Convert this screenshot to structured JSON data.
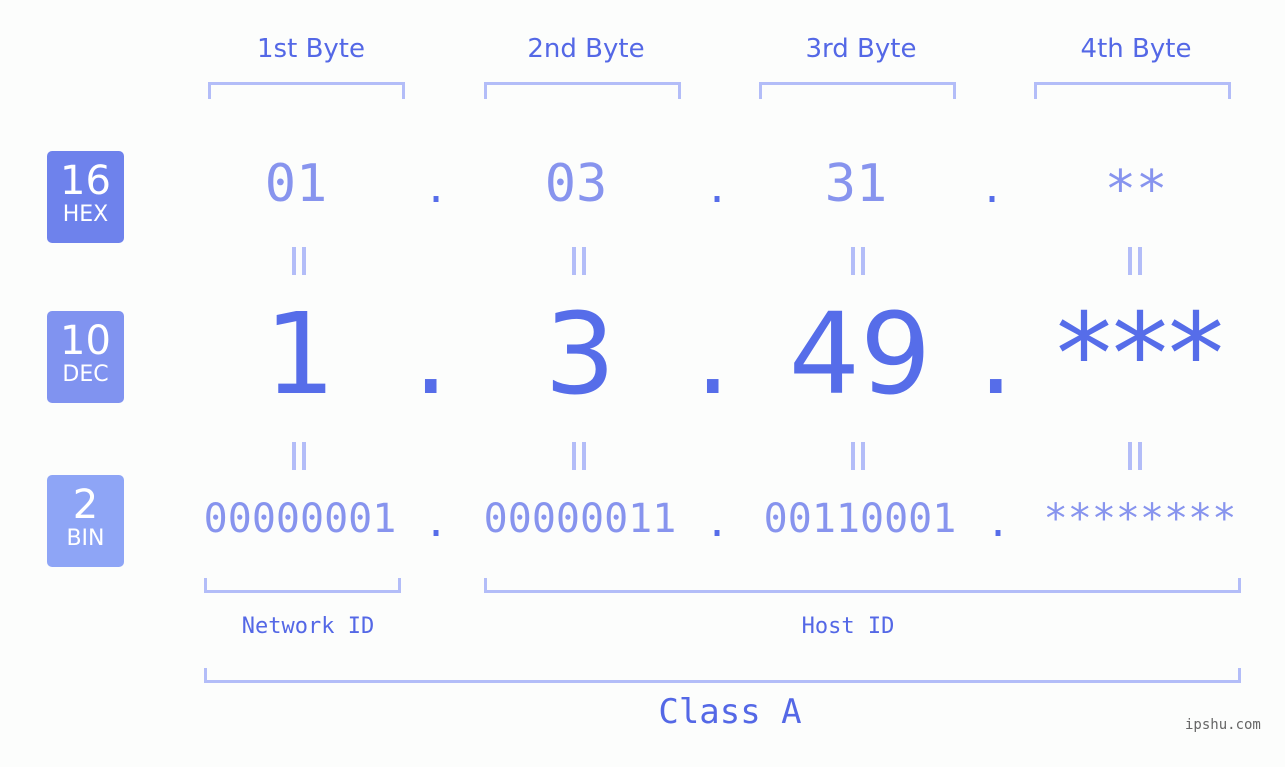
{
  "headers": [
    "1st Byte",
    "2nd Byte",
    "3rd Byte",
    "4th Byte"
  ],
  "badges": [
    {
      "num": "16",
      "label": "HEX",
      "color": "#6e82ec"
    },
    {
      "num": "10",
      "label": "DEC",
      "color": "#8093f0"
    },
    {
      "num": "2",
      "label": "BIN",
      "color": "#8ea5f6"
    }
  ],
  "hex": [
    "01",
    "03",
    "31",
    "**"
  ],
  "dec": [
    "1",
    "3",
    "49",
    "***"
  ],
  "bin": [
    "00000001",
    "00000011",
    "00110001",
    "********"
  ],
  "separator": ".",
  "equals": "=",
  "network_label": "Network ID",
  "host_label": "Host ID",
  "class_label": "Class A",
  "watermark": "ipshu.com"
}
